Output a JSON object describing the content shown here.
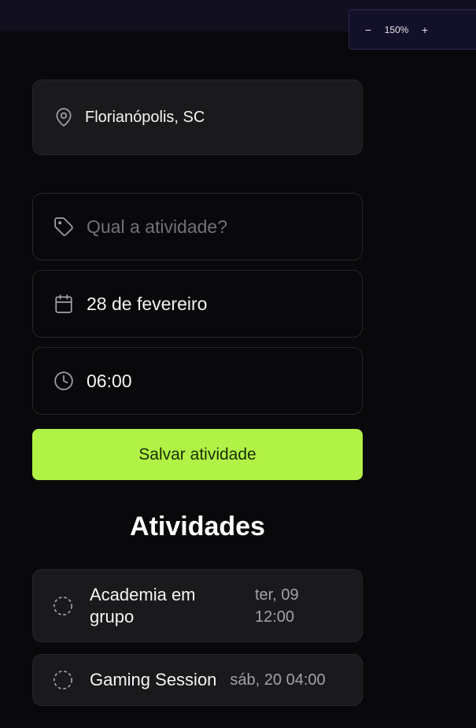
{
  "zoom": {
    "minus": "−",
    "value": "150%",
    "plus": "+"
  },
  "location": {
    "text": "Florianópolis, SC"
  },
  "form": {
    "activity_placeholder": "Qual a atividade?",
    "date": "28 de fevereiro",
    "time": "06:00",
    "save_label": "Salvar atividade"
  },
  "activities": {
    "title": "Atividades",
    "items": [
      {
        "name": "Academia em grupo",
        "when": "ter, 09 12:00"
      },
      {
        "name": "Gaming Session",
        "when": "sáb, 20 04:00"
      }
    ]
  },
  "colors": {
    "accent": "#b1f246",
    "background": "#09090b",
    "card": "#1a1a1d"
  }
}
